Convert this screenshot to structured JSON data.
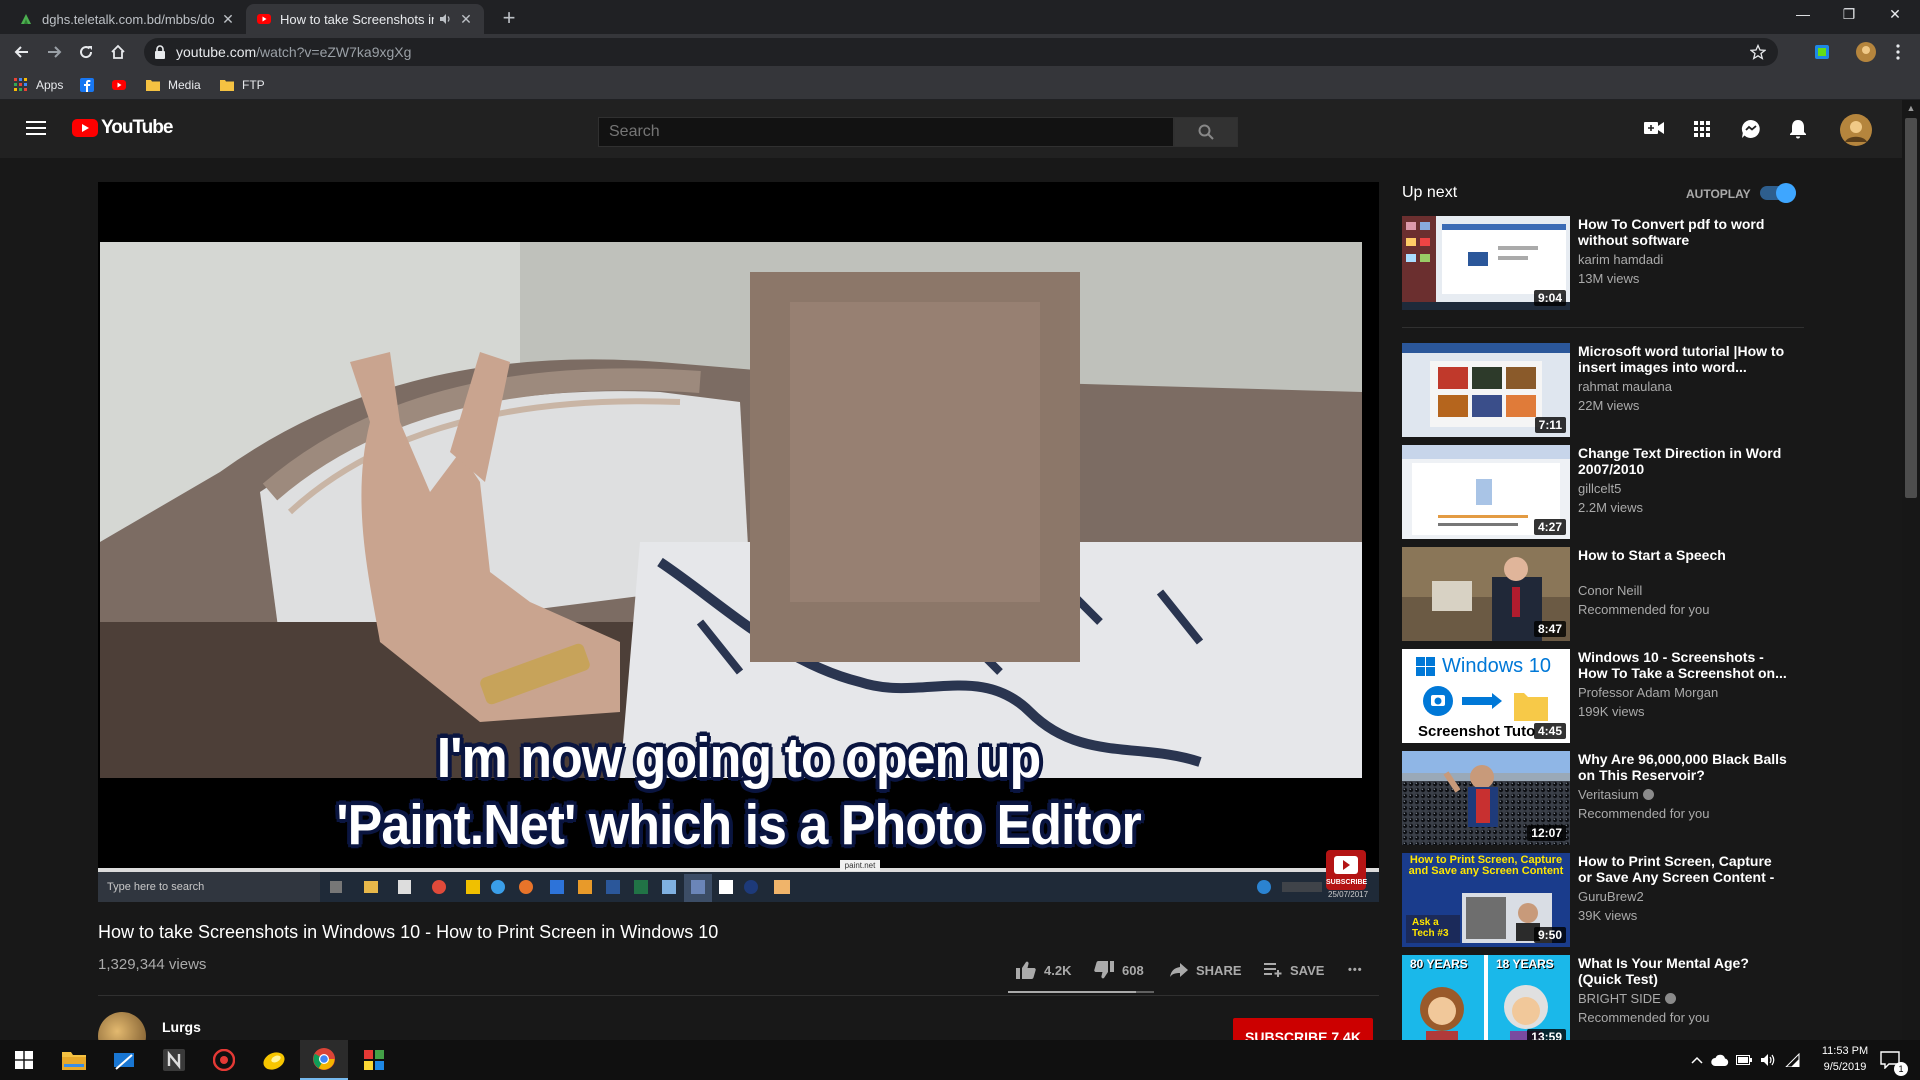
{
  "browser": {
    "tabs": [
      {
        "title": "dghs.teletalk.com.bd/mbbs/docs",
        "close": "✕"
      },
      {
        "title": "How to take Screenshots in W",
        "close": "✕"
      }
    ],
    "new_tab": "+",
    "window_controls": {
      "minimize": "—",
      "restore": "❐",
      "close": "✕"
    },
    "url_host": "youtube.com",
    "url_path": "/watch?v=eZW7ka9xgXg",
    "bookmarks": [
      {
        "label": "Apps"
      },
      {
        "label": ""
      },
      {
        "label": ""
      },
      {
        "label": "Media"
      },
      {
        "label": "FTP"
      }
    ]
  },
  "youtube": {
    "logo_text": "YouTube",
    "search_placeholder": "Search",
    "video": {
      "caption_line1": "I'm now going to open up",
      "caption_line2": "'Paint.Net' which is a Photo Editor",
      "in_video_search": "Type here to search",
      "in_video_tooltip": "paint.net",
      "in_video_watermark": "SUBSCRIBE",
      "in_video_date": "25/07/2017",
      "title": "How to take Screenshots in Windows 10 - How to Print Screen in Windows 10",
      "views": "1,329,344 views",
      "likes": "4.2K",
      "dislikes": "608",
      "share": "SHARE",
      "save": "SAVE",
      "more": "•••",
      "channel": "Lurgs",
      "subscribe": "SUBSCRIBE 7.4K"
    },
    "upnext": {
      "title": "Up next",
      "autoplay_label": "AUTOPLAY",
      "autoplay_on": true,
      "items": [
        {
          "title": "How To Convert pdf to word without software",
          "channel": "karim hamdadi",
          "meta": "13M views",
          "duration": "9:04",
          "verified": false
        },
        {
          "title": "Microsoft word tutorial |How to insert images into word...",
          "channel": "rahmat maulana",
          "meta": "22M views",
          "duration": "7:11",
          "verified": false
        },
        {
          "title": "Change Text Direction in Word 2007/2010",
          "channel": "gillcelt5",
          "meta": "2.2M views",
          "duration": "4:27",
          "verified": false
        },
        {
          "title": "How to Start a Speech",
          "channel": "Conor Neill",
          "meta": "Recommended for you",
          "duration": "8:47",
          "verified": false
        },
        {
          "title": "Windows 10 - Screenshots - How To Take a Screenshot on...",
          "channel": "Professor Adam Morgan",
          "meta": "199K views",
          "duration": "4:45",
          "verified": false,
          "thumb_text_1": "Windows 10",
          "thumb_text_2": "Screenshot Tuto"
        },
        {
          "title": "Why Are 96,000,000 Black Balls on This Reservoir?",
          "channel": "Veritasium",
          "meta": "Recommended for you",
          "duration": "12:07",
          "verified": true
        },
        {
          "title": "How to Print Screen, Capture or Save Any Screen Content - As...",
          "channel": "GuruBrew2",
          "meta": "39K views",
          "duration": "9:50",
          "verified": false,
          "thumb_text_1": "How to Print Screen, Capture and Save any Screen Content",
          "thumb_text_2": "Ask a Tech #3"
        },
        {
          "title": "What Is Your Mental Age? (Quick Test)",
          "channel": "BRIGHT SIDE",
          "meta": "Recommended for you",
          "duration": "13:59",
          "verified": true,
          "thumb_text_1": "80 YEARS",
          "thumb_text_2": "18 YEARS"
        }
      ]
    }
  },
  "taskbar": {
    "clock_time": "11:53 PM",
    "clock_date": "9/5/2019",
    "notifications_count": "1"
  },
  "colors": {
    "youtube_red": "#ff0000",
    "subscribe_red": "#cc0000",
    "autoplay_blue": "#3ea6ff",
    "taskbar_accent": "#76b9ed"
  }
}
